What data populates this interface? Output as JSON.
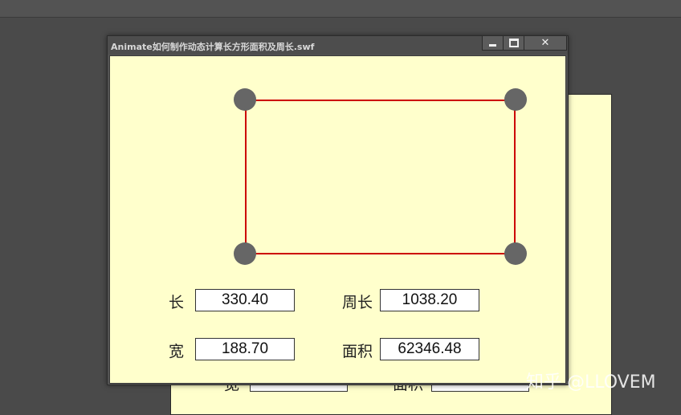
{
  "window": {
    "title": "Animate如何制作动态计算长方形面积及周长.swf",
    "controls": {
      "minimize": "minimize",
      "maximize": "maximize",
      "close": "close"
    }
  },
  "colors": {
    "stage_background": "#ffffcc",
    "rectangle_stroke": "#cc0000",
    "handle_fill": "#666666"
  },
  "fields": {
    "length": {
      "label": "长",
      "value": "330.40"
    },
    "perimeter": {
      "label": "周长",
      "value": "1038.20"
    },
    "width": {
      "label": "宽",
      "value": "188.70"
    },
    "area": {
      "label": "面积",
      "value": "62346.48"
    }
  },
  "background_stage": {
    "width_label": "宽",
    "area_label": "面积"
  },
  "watermark": "知乎 @LLOVEM"
}
